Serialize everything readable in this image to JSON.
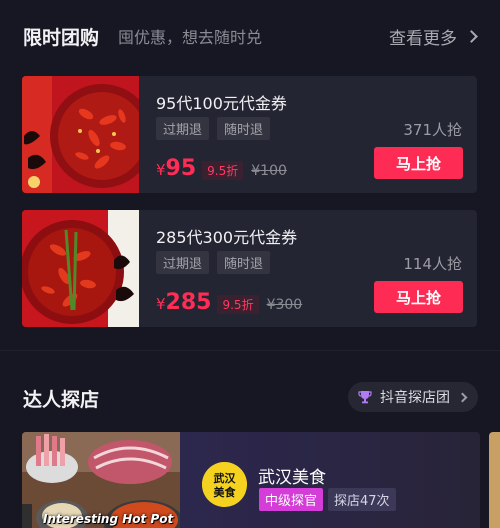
{
  "group_buy": {
    "title": "限时团购",
    "subtitle": "囤优惠，想去随时兑",
    "more_label": "查看更多",
    "deals": [
      {
        "name": "95代100元代金券",
        "tags": [
          "过期退",
          "随时退"
        ],
        "sold": "371人抢",
        "currency": "¥",
        "price": "95",
        "discount": "9.5折",
        "original_price": "¥100",
        "buy_label": "马上抢"
      },
      {
        "name": "285代300元代金券",
        "tags": [
          "过期退",
          "随时退"
        ],
        "sold": "114人抢",
        "currency": "¥",
        "price": "285",
        "discount": "9.5折",
        "original_price": "¥300",
        "buy_label": "马上抢"
      }
    ]
  },
  "influencers": {
    "title": "达人探店",
    "pill_label": "抖音探店团",
    "card": {
      "photo_caption": "Interesting Hot Pot",
      "avatar_text": "武汉美食",
      "name": "武汉美食",
      "badge": "中级探官",
      "visits": "探店47次"
    }
  },
  "colors": {
    "background": "#161722",
    "card": "#242532",
    "accent": "#fe2c55",
    "badge": "#d43dd8"
  },
  "icons": [
    "chevron-right-icon",
    "trophy-icon"
  ]
}
